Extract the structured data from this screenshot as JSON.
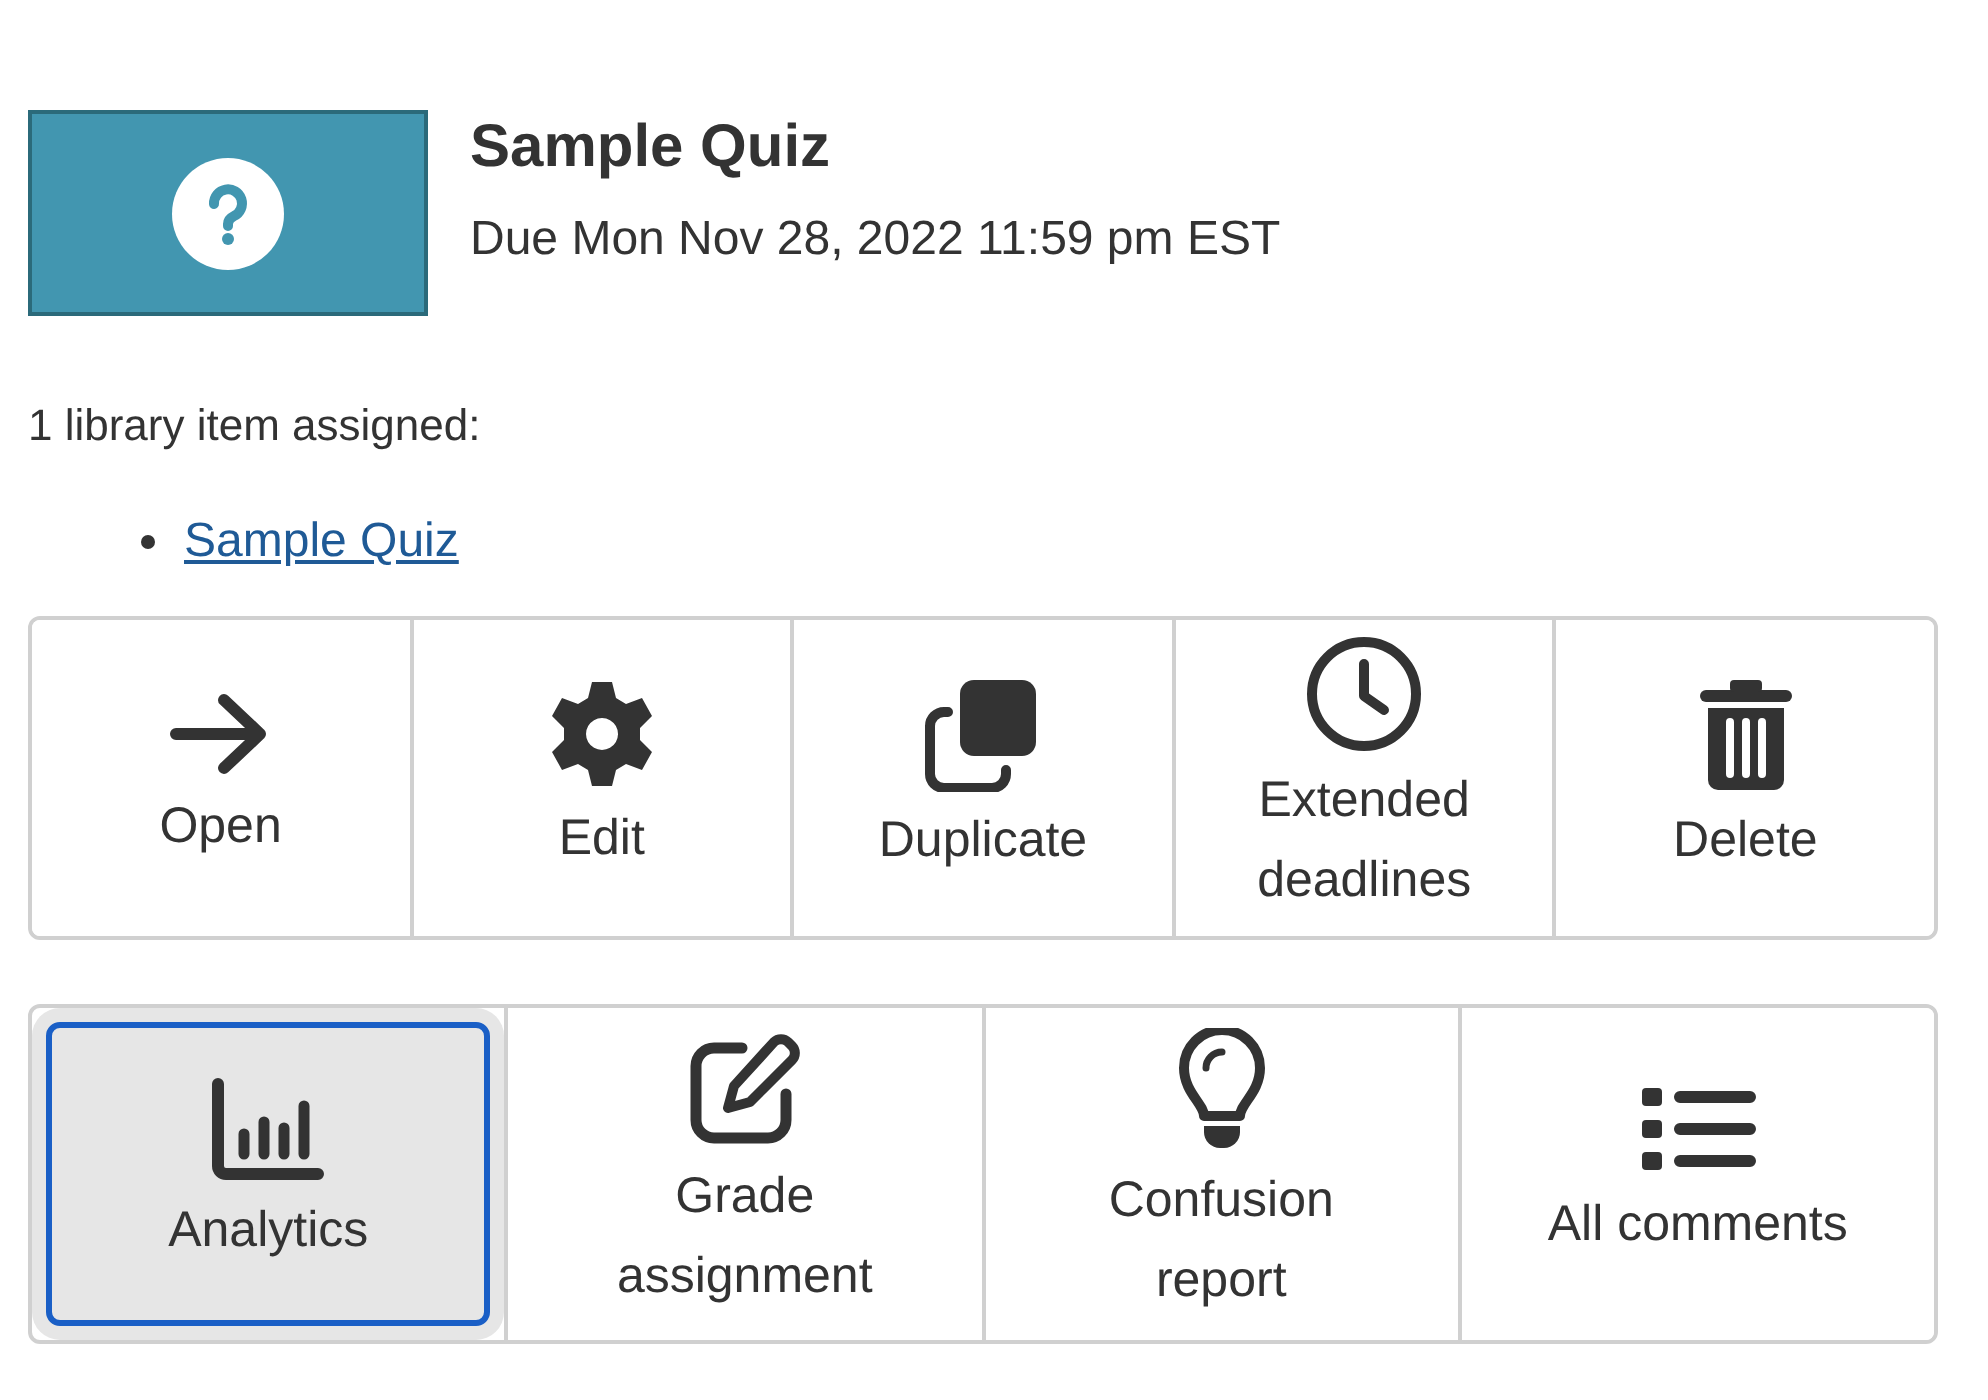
{
  "assignment": {
    "title": "Sample Quiz",
    "due": "Due Mon Nov 28, 2022 11:59 pm EST"
  },
  "assigned_text": "1 library item assigned:",
  "library_items": [
    {
      "label": "Sample Quiz"
    }
  ],
  "action_rows": [
    [
      {
        "kind": "open",
        "label": "Open",
        "selected": false
      },
      {
        "kind": "edit",
        "label": "Edit",
        "selected": false
      },
      {
        "kind": "duplicate",
        "label": "Duplicate",
        "selected": false
      },
      {
        "kind": "deadlines",
        "label": "Extended\ndeadlines",
        "selected": false
      },
      {
        "kind": "delete",
        "label": "Delete",
        "selected": false
      }
    ],
    [
      {
        "kind": "analytics",
        "label": "Analytics",
        "selected": true
      },
      {
        "kind": "grade",
        "label": "Grade\nassignment",
        "selected": false
      },
      {
        "kind": "confusion",
        "label": "Confusion\nreport",
        "selected": false
      },
      {
        "kind": "comments",
        "label": "All comments",
        "selected": false
      }
    ]
  ]
}
